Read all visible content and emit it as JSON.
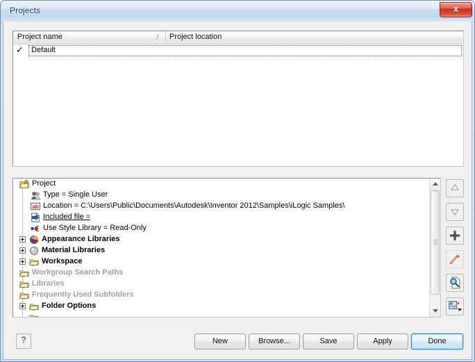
{
  "window": {
    "title": "Projects",
    "close_label": "x"
  },
  "project_list": {
    "columns": [
      {
        "label": "Project name"
      },
      {
        "label": "Project location"
      }
    ],
    "sort_indicator": "/",
    "rows": [
      {
        "check": "✓",
        "name": "Default",
        "location": ""
      }
    ]
  },
  "tree": {
    "nodes": [
      {
        "label": "Project",
        "icon": "folder-open-icon",
        "indent": 0,
        "expander": false,
        "style": "normal"
      },
      {
        "label": "Type = Single User",
        "icon": "user-icon",
        "indent": 1,
        "expander": false,
        "style": "normal"
      },
      {
        "label": "Location = C:\\Users\\Public\\Documents\\Autodesk\\Inventor 2012\\Samples\\iLogic Samples\\",
        "icon": "ab-text-icon",
        "indent": 1,
        "expander": false,
        "style": "normal"
      },
      {
        "label": "Included file = ",
        "icon": "included-file-icon",
        "indent": 1,
        "expander": false,
        "style": "underline"
      },
      {
        "label": "Use Style Library = Read-Only",
        "icon": "style-library-icon",
        "indent": 1,
        "expander": false,
        "style": "normal"
      },
      {
        "label": "Appearance Libraries",
        "icon": "appearance-icon",
        "indent": 0,
        "expander": true,
        "style": "bold"
      },
      {
        "label": "Material Libraries",
        "icon": "material-icon",
        "indent": 0,
        "expander": true,
        "style": "bold"
      },
      {
        "label": "Workspace",
        "icon": "folder-icon",
        "indent": 0,
        "expander": true,
        "style": "bold"
      },
      {
        "label": "Workgroup Search Paths",
        "icon": "folder-icon",
        "indent": 0,
        "expander": false,
        "style": "gray"
      },
      {
        "label": "Libraries",
        "icon": "folder-icon",
        "indent": 0,
        "expander": false,
        "style": "gray"
      },
      {
        "label": "Frequently Used Subfolders",
        "icon": "folder-icon",
        "indent": 0,
        "expander": false,
        "style": "gray"
      },
      {
        "label": "Folder Options",
        "icon": "folder-icon",
        "indent": 0,
        "expander": true,
        "style": "bold"
      }
    ]
  },
  "side_toolbar": {
    "buttons": [
      {
        "name": "move-up-button",
        "icon": "arrow-up-icon"
      },
      {
        "name": "move-down-button",
        "icon": "arrow-down-icon"
      },
      {
        "name": "add-button",
        "icon": "plus-icon"
      },
      {
        "name": "edit-button",
        "icon": "pencil-icon"
      },
      {
        "name": "browse-path-button",
        "icon": "magnifier-page-icon"
      },
      {
        "name": "configure-editor-button",
        "icon": "edit-options-icon"
      }
    ]
  },
  "footer": {
    "help_label": "?",
    "buttons": [
      {
        "label": "New",
        "name": "new-button",
        "default": false
      },
      {
        "label": "Browse...",
        "name": "browse-button",
        "default": false
      },
      {
        "label": "Save",
        "name": "save-button",
        "default": false
      },
      {
        "label": "Apply",
        "name": "apply-button",
        "default": false
      },
      {
        "label": "Done",
        "name": "done-button",
        "default": true
      }
    ]
  },
  "colors": {
    "title_text": "#15406b",
    "close_red": "#c42f1c",
    "default_button_border": "#3d8fd0",
    "disabled_text": "#a0a0a0",
    "folder_yellow": "#e8d58a"
  }
}
